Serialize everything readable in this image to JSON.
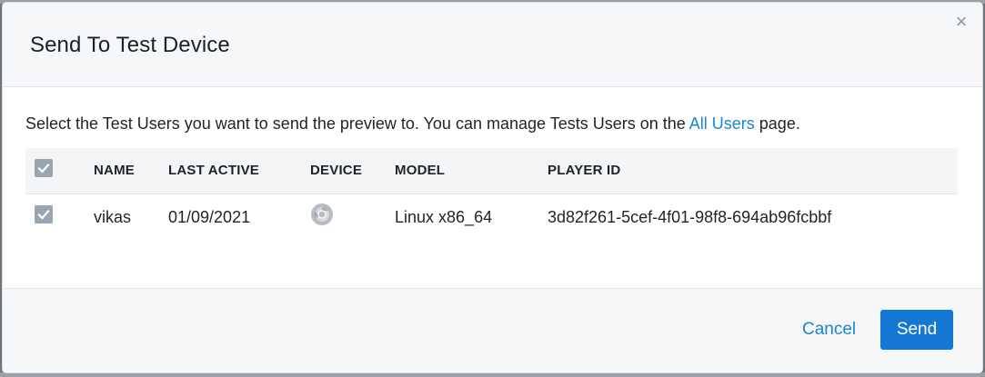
{
  "dialog": {
    "title": "Send To Test Device",
    "close_label": "×"
  },
  "intro": {
    "before_link": "Select the Test Users you want to send the preview to. You can manage Tests Users on the ",
    "link_text": "All Users",
    "after_link": " page."
  },
  "table": {
    "columns": [
      "NAME",
      "LAST ACTIVE",
      "DEVICE",
      "MODEL",
      "PLAYER ID"
    ],
    "header_checked": true,
    "rows": [
      {
        "checked": true,
        "name": "vikas",
        "last_active": "01/09/2021",
        "device_icon": "chrome-icon",
        "model": "Linux x86_64",
        "player_id": "3d82f261-5cef-4f01-98f8-694ab96fcbbf"
      }
    ]
  },
  "footer": {
    "cancel_label": "Cancel",
    "send_label": "Send"
  },
  "colors": {
    "accent": "#1a86d0",
    "primary_button": "#1478d4",
    "checkbox": "#9aa5b1"
  }
}
